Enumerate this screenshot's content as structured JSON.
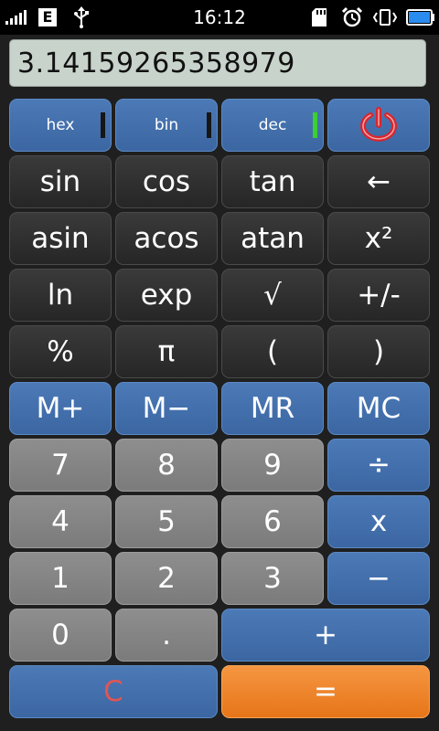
{
  "status_bar": {
    "time": "16:12",
    "e_label": "E",
    "icons": [
      "signal-icon",
      "e-network-icon",
      "usb-icon",
      "sd-card-icon",
      "alarm-icon",
      "vibrate-icon",
      "battery-icon"
    ]
  },
  "display": {
    "value": "3.14159265358979"
  },
  "colors": {
    "blue": "#3f6ea9",
    "dark": "#2e2e2e",
    "gray": "#858585",
    "orange": "#ee8426",
    "indicator_active": "#3bd02f",
    "power_red": "#d8262e"
  },
  "modes": {
    "hex": "hex",
    "bin": "bin",
    "dec": "dec",
    "active": "dec"
  },
  "keys": {
    "sin": "sin",
    "cos": "cos",
    "tan": "tan",
    "backspace": "←",
    "asin": "asin",
    "acos": "acos",
    "atan": "atan",
    "square": "x²",
    "ln": "ln",
    "exp": "exp",
    "sqrt": "√",
    "sign": "+/-",
    "percent": "%",
    "pi": "π",
    "lparen": "(",
    "rparen": ")",
    "mplus": "M+",
    "mminus": "M−",
    "mr": "MR",
    "mc": "MC",
    "d7": "7",
    "d8": "8",
    "d9": "9",
    "divide": "÷",
    "d4": "4",
    "d5": "5",
    "d6": "6",
    "multiply": "x",
    "d1": "1",
    "d2": "2",
    "d3": "3",
    "minus": "−",
    "d0": "0",
    "dot": ".",
    "plus": "+",
    "clear": "C",
    "equals": "="
  }
}
